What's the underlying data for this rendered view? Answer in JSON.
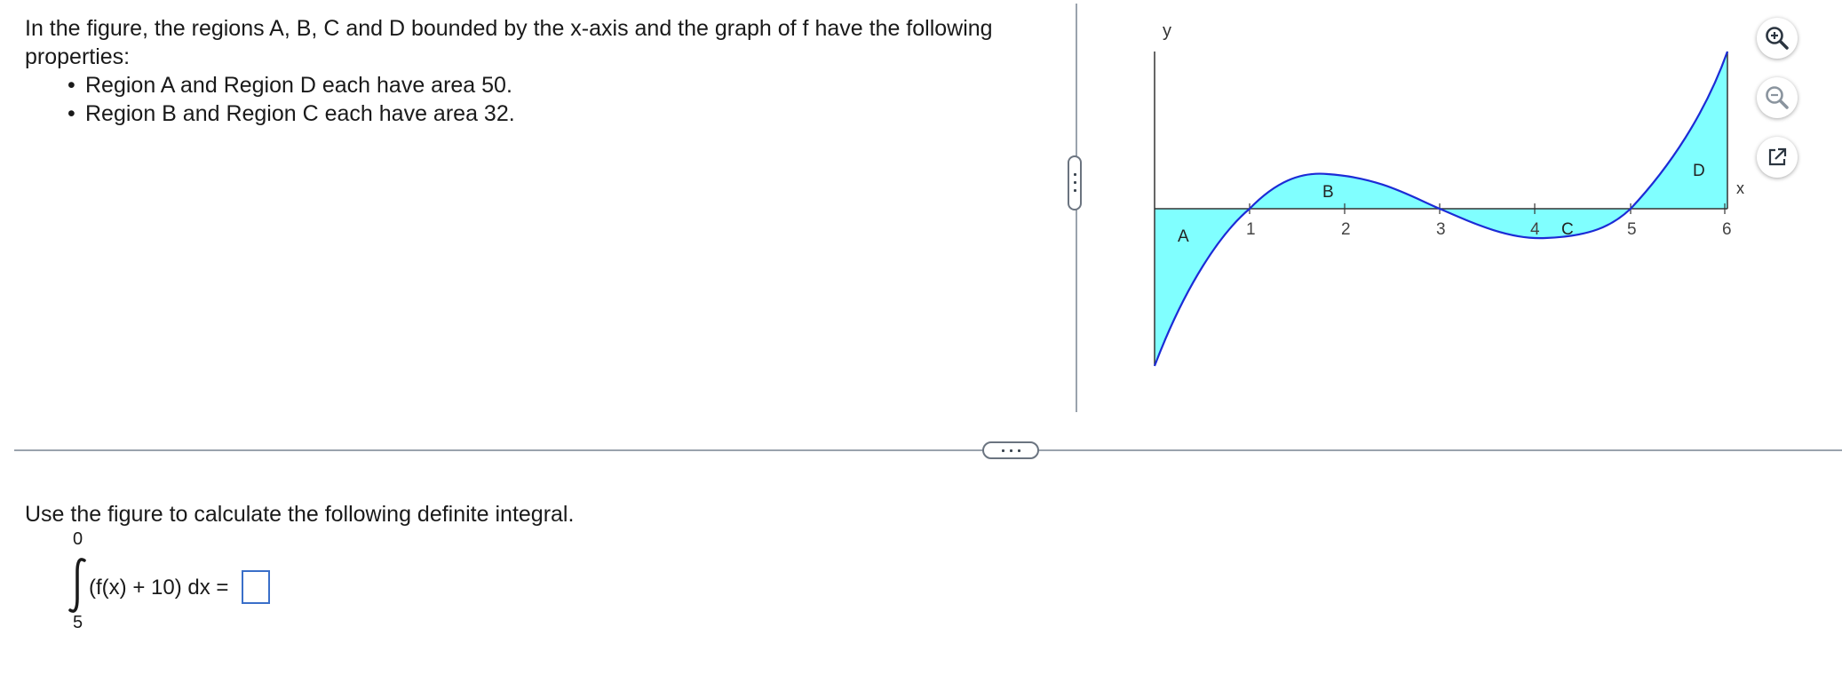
{
  "problem": {
    "intro": "In the figure, the regions A, B, C and D bounded by the x-axis and the graph of f have the following properties:",
    "bullets": [
      "Region A and Region D each have area 50.",
      "Region B and Region C each have area 32."
    ]
  },
  "graph": {
    "y_label": "y",
    "x_label": "x",
    "x_ticks": [
      "1",
      "2",
      "3",
      "4",
      "5",
      "6"
    ],
    "region_labels": [
      "A",
      "B",
      "C",
      "D"
    ],
    "fill_color": "#80ffff",
    "curve_color": "#1c2bd6"
  },
  "tools": {
    "zoom_in_icon": "zoom-in-icon",
    "zoom_out_icon": "zoom-out-icon",
    "popout_icon": "external-link-icon"
  },
  "question": {
    "prompt": "Use the figure to calculate the following definite integral.",
    "upper_limit": "0",
    "lower_limit": "5",
    "integrand": "(f(x) + 10) dx =",
    "answer": ""
  }
}
